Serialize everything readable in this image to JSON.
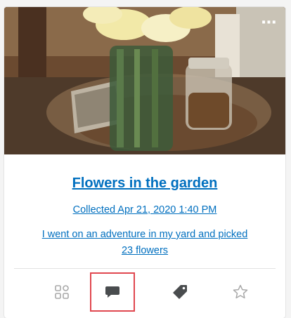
{
  "card": {
    "title": "Flowers in the garden",
    "collected": "Collected Apr 21, 2020 1:40 PM",
    "description": "I went on an adventure in my yard and picked 23 flowers"
  },
  "actions": [
    {
      "name": "attach-icon",
      "selected": false
    },
    {
      "name": "comment-icon",
      "selected": true
    },
    {
      "name": "tag-icon",
      "selected": false
    },
    {
      "name": "star-icon",
      "selected": false
    }
  ],
  "colors": {
    "link": "#006fbf",
    "highlight": "#e0474f",
    "icon_inactive": "#a8a8a8",
    "icon_active": "#494c4e"
  }
}
